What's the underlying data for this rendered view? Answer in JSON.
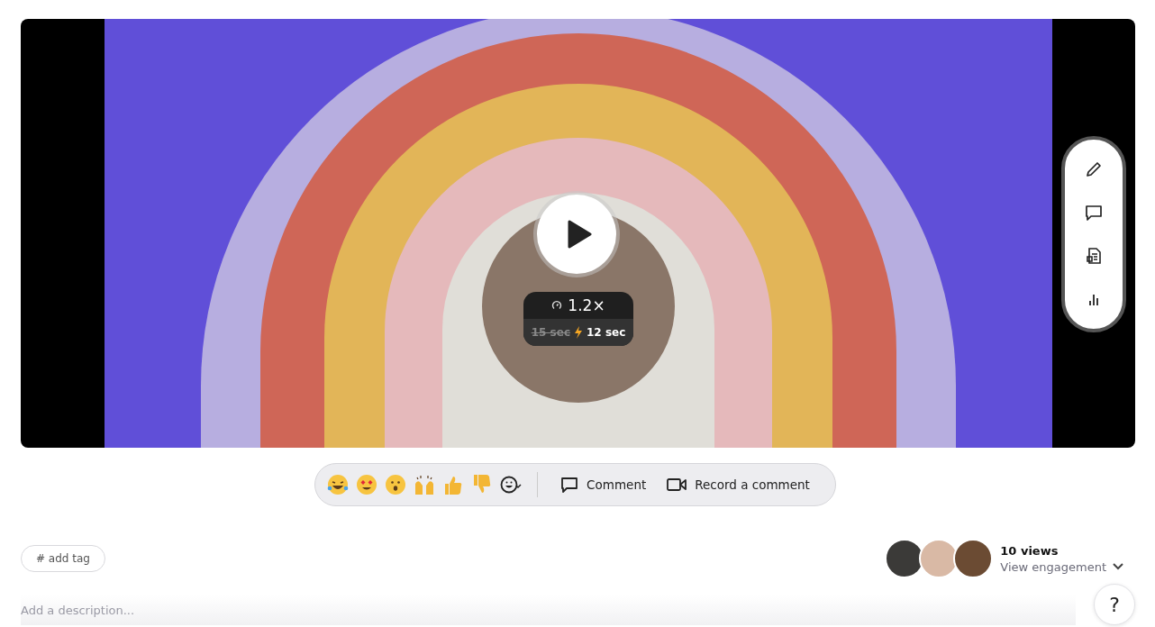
{
  "player": {
    "speed": "1.2×",
    "original_duration": "15 sec",
    "new_duration": "12 sec"
  },
  "reactions": {
    "actions": [
      {
        "kind": "comment",
        "label": "Comment"
      },
      {
        "kind": "record",
        "label": "Record a comment"
      }
    ]
  },
  "tag": {
    "label": "# add tag"
  },
  "views": {
    "count": "10 views",
    "engagement": "View engagement"
  },
  "help": {
    "label": "?"
  },
  "description": {
    "placeholder": "Add a description..."
  }
}
